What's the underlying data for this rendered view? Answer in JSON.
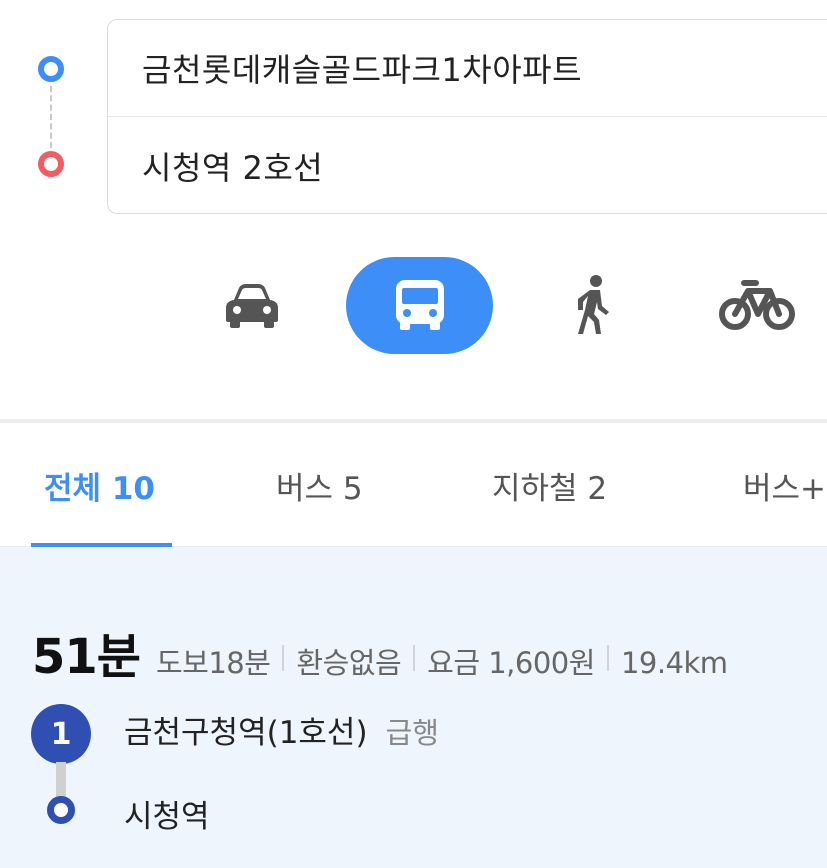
{
  "route": {
    "origin": "금천롯데캐슬골드파크1차아파트",
    "destination": "시청역 2호선"
  },
  "modes": [
    {
      "name": "car",
      "icon": "car-icon"
    },
    {
      "name": "transit",
      "icon": "bus-icon",
      "selected": true
    },
    {
      "name": "walk",
      "icon": "walking-person-icon"
    },
    {
      "name": "bike",
      "icon": "bicycle-icon"
    }
  ],
  "tabs": [
    {
      "label": "전체 10",
      "active": true
    },
    {
      "label": "버스 5"
    },
    {
      "label": "지하철 2"
    },
    {
      "label": "버스+"
    }
  ],
  "result": {
    "duration": "51분",
    "walk": "도보18분",
    "transfer": "환승없음",
    "fare": "요금 1,600원",
    "distance": "19.4km",
    "step_number": "1",
    "start_station": "금천구청역(1호선)",
    "train_type": "급행",
    "end_station": "시청역"
  },
  "colors": {
    "accent": "#3d8ef7",
    "origin_marker": "#3d8ef7",
    "destination_marker": "#f45c63",
    "line_1": "#2f4fb2",
    "result_bg": "#eef5fd"
  }
}
